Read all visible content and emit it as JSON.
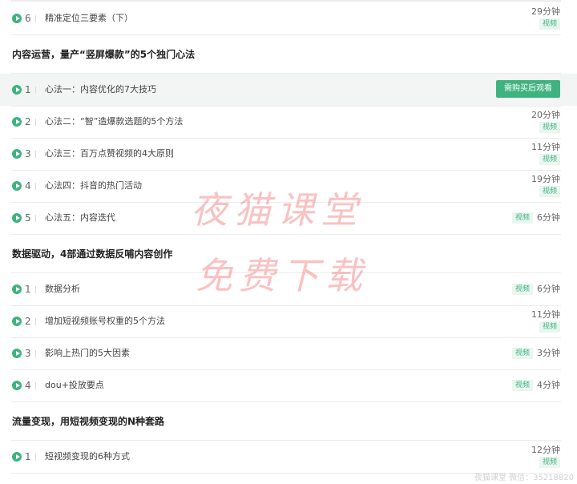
{
  "sections": [
    {
      "title": "内容运营，量产“竖屏爆款”的5个独门心法"
    },
    {
      "title": "数据驱动，4部通过数据反哺内容创作"
    },
    {
      "title": "流量变现，用短视频变现的N种套路"
    }
  ],
  "lessons": [
    {
      "num": "6",
      "title": "精准定位三要素（下）",
      "duration": "29分钟",
      "tag": "视频"
    },
    {
      "num": "1",
      "title": "心法一：内容优化的7大技巧",
      "button": "需购买后观看"
    },
    {
      "num": "2",
      "title": "心法二：“智”造爆款选题的5个方法",
      "duration": "20分钟",
      "tag": "视频"
    },
    {
      "num": "3",
      "title": "心法三：百万点赞视频的4大原则",
      "duration": "11分钟",
      "tag": "视频"
    },
    {
      "num": "4",
      "title": "心法四：抖音的热门活动",
      "duration": "19分钟",
      "tag": "视频"
    },
    {
      "num": "5",
      "title": "心法五：内容迭代",
      "duration": "6分钟",
      "tag": "视频"
    },
    {
      "num": "1",
      "title": "数据分析",
      "duration": "6分钟",
      "tag": "视频"
    },
    {
      "num": "2",
      "title": "增加短视频账号权重的5个方法",
      "duration": "11分钟",
      "tag": "视频"
    },
    {
      "num": "3",
      "title": "影响上热门的5大因素",
      "duration": "3分钟",
      "tag": "视频"
    },
    {
      "num": "4",
      "title": "dou+投放要点",
      "duration": "4分钟",
      "tag": "视频"
    },
    {
      "num": "1",
      "title": "短视频变现的6种方式",
      "duration": "12分钟",
      "tag": "视频"
    }
  ],
  "watermark": {
    "line1": "夜猫课堂",
    "line2": "免费下载"
  },
  "footer_watermark": "夜猫课堂 微信：35218820"
}
